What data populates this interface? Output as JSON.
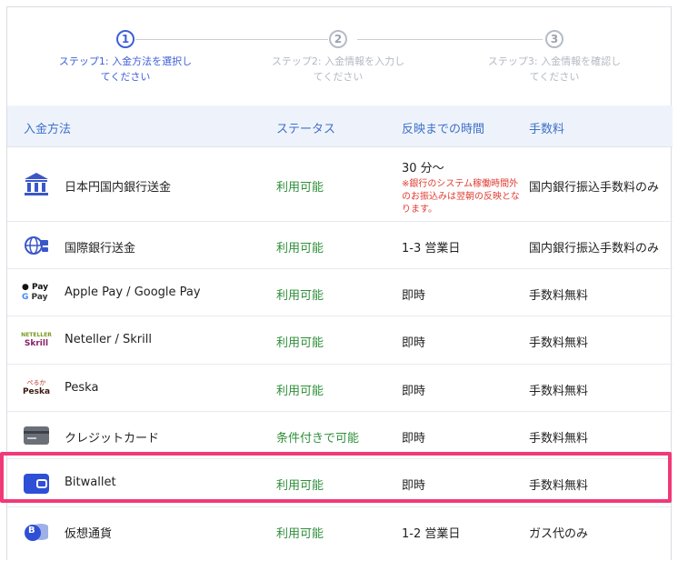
{
  "steps": [
    {
      "number": "1",
      "label_line1": "ステップ1: 入金方法を選択し",
      "label_line2": "てください"
    },
    {
      "number": "2",
      "label_line1": "ステップ2: 入金情報を入力し",
      "label_line2": "てください"
    },
    {
      "number": "3",
      "label_line1": "ステップ3: 入金情報を確認し",
      "label_line2": "てください"
    }
  ],
  "table": {
    "headers": {
      "method": "入金方法",
      "status": "ステータス",
      "time": "反映までの時間",
      "fee": "手数料"
    },
    "rows": [
      {
        "icon": "bank-icon",
        "method": "日本円国内銀行送金",
        "status": "利用可能",
        "time": "30 分〜",
        "note": "※銀行のシステム稼働時間外のお振込みは翌朝の反映となります。",
        "fee": "国内銀行振込手数料のみ"
      },
      {
        "icon": "global-transfer-icon",
        "method": "国際銀行送金",
        "status": "利用可能",
        "time": "1-3 営業日",
        "fee": "国内銀行振込手数料のみ"
      },
      {
        "icon": "apple-google-pay-icon",
        "method": "Apple Pay / Google Pay",
        "status": "利用可能",
        "time": "即時",
        "fee": "手数料無料"
      },
      {
        "icon": "neteller-skrill-icon",
        "method": "Neteller / Skrill",
        "status": "利用可能",
        "time": "即時",
        "fee": "手数料無料"
      },
      {
        "icon": "peska-icon",
        "method": "Peska",
        "status": "利用可能",
        "time": "即時",
        "fee": "手数料無料"
      },
      {
        "icon": "credit-card-icon",
        "method": "クレジットカード",
        "status": "条件付きで可能",
        "time": "即時",
        "fee": "手数料無料"
      },
      {
        "icon": "wallet-icon",
        "method": "Bitwallet",
        "status": "利用可能",
        "time": "即時",
        "fee": "手数料無料"
      },
      {
        "icon": "crypto-coin-icon",
        "method": "仮想通貨",
        "status": "利用可能",
        "time": "1-2 営業日",
        "fee": "ガス代のみ"
      }
    ]
  },
  "icon_text": {
    "pay": "Pay",
    "neteller": "NETELLER",
    "skrill": "Skrill",
    "peska_kana": "ぺるか",
    "peska": "Peska",
    "bitcoin": "B"
  },
  "colors": {
    "accent": "#3f5fd7",
    "available": "#2f8f3a",
    "note_red": "#e03c31",
    "highlight": "#f03a78",
    "header_bg": "#eef3fb"
  }
}
